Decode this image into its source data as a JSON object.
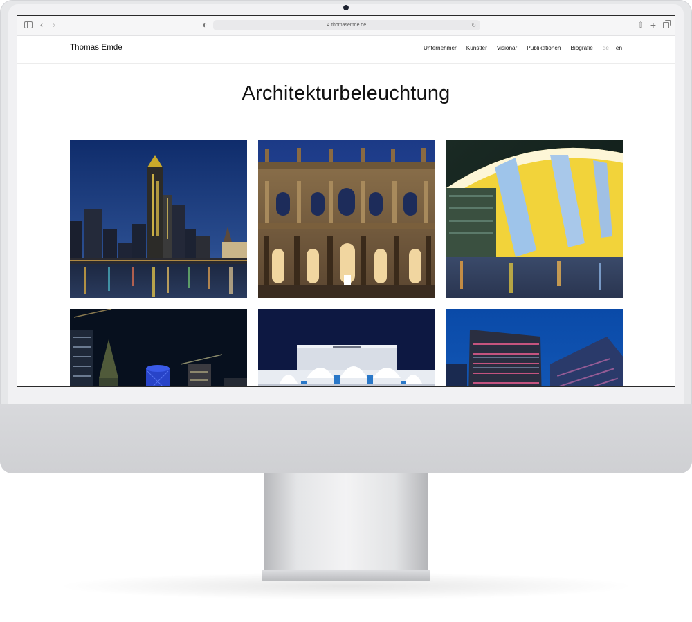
{
  "browser": {
    "url": "thomasemde.de"
  },
  "site": {
    "logo": "Thomas Emde",
    "nav": [
      "Unternehmer",
      "Künstler",
      "Visionär",
      "Publikationen",
      "Biografie"
    ],
    "lang_de": "de",
    "lang_en": "en"
  },
  "page": {
    "title": "Architekturbeleuchtung"
  }
}
